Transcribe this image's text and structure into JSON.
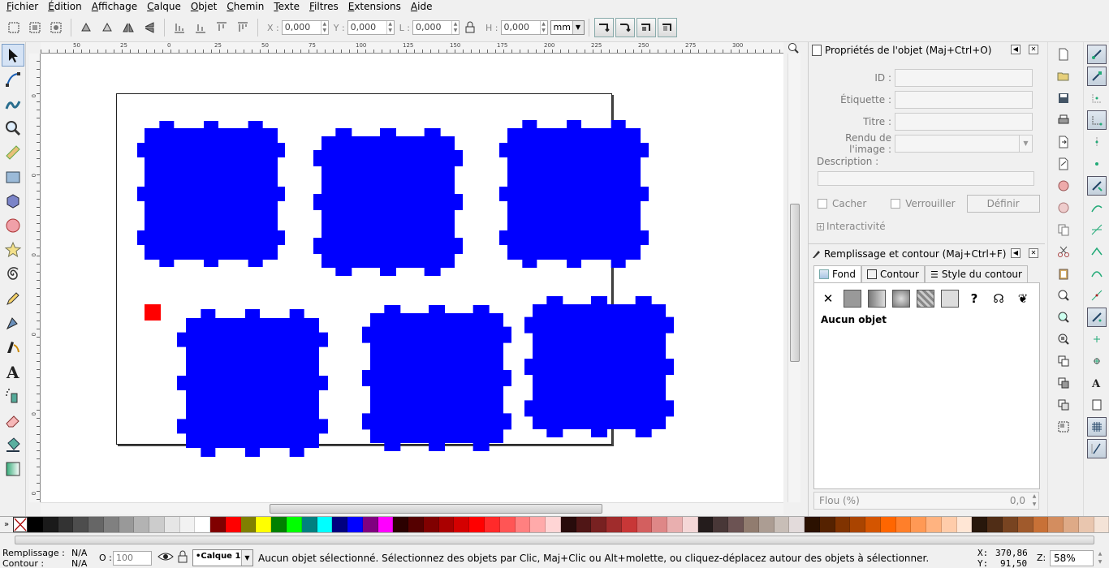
{
  "menu": [
    "Fichier",
    "Édition",
    "Affichage",
    "Calque",
    "Objet",
    "Chemin",
    "Texte",
    "Filtres",
    "Extensions",
    "Aide"
  ],
  "toolbar": {
    "x_label": "X :",
    "x_value": "0,000",
    "y_label": "Y :",
    "y_value": "0,000",
    "w_label": "L :",
    "w_value": "0,000",
    "h_label": "H :",
    "h_value": "0,000",
    "unit": "mm"
  },
  "ruler_top_labels": [
    "50",
    "25",
    "0",
    "25",
    "50",
    "75",
    "100",
    "125",
    "150",
    "175",
    "200",
    "225",
    "250",
    "275",
    "300"
  ],
  "ruler_left_labels": [
    "0",
    "0",
    "0",
    "0",
    "0",
    "0"
  ],
  "canvas": {
    "piece_color": "#0000ff",
    "marker_color": "#ff0000",
    "page_border_color": "#222222"
  },
  "object_properties": {
    "title": "Propriétés de l'objet (Maj+Ctrl+O)",
    "id_label": "ID :",
    "label_label": "Étiquette :",
    "title_label": "Titre :",
    "render_label": "Rendu de l'image :",
    "description_label": "Description :",
    "hide_label": "Cacher",
    "lock_label": "Verrouiller",
    "set_button": "Définir",
    "interactivity_label": "Interactivité"
  },
  "fill_stroke": {
    "title": "Remplissage et contour (Maj+Ctrl+F)",
    "tab_fill": "Fond",
    "tab_stroke": "Contour",
    "tab_stroke_style": "Style du contour",
    "no_object": "Aucun objet",
    "blur_label": "Flou (%)",
    "blur_value": "0,0"
  },
  "palette_colors": [
    "#000000",
    "#1a1a1a",
    "#333333",
    "#4d4d4d",
    "#666666",
    "#808080",
    "#999999",
    "#b3b3b3",
    "#cccccc",
    "#e6e6e6",
    "#f2f2f2",
    "#ffffff",
    "#800000",
    "#ff0000",
    "#808000",
    "#ffff00",
    "#008000",
    "#00ff00",
    "#008080",
    "#00ffff",
    "#000080",
    "#0000ff",
    "#800080",
    "#ff00ff",
    "#2b0000",
    "#550000",
    "#800000",
    "#aa0000",
    "#d40000",
    "#ff0000",
    "#ff2a2a",
    "#ff5555",
    "#ff8080",
    "#ffaaaa",
    "#ffd5d5",
    "#280b0b",
    "#501616",
    "#782121",
    "#a02c2c",
    "#c83737",
    "#d35f5f",
    "#de8787",
    "#e9afaf",
    "#f4d7d7",
    "#241c1c",
    "#483737",
    "#6c5353",
    "#917c6f",
    "#ac9d93",
    "#c8beb7",
    "#e3dbdb",
    "#2b1100",
    "#552200",
    "#803300",
    "#aa4400",
    "#d45500",
    "#ff6600",
    "#ff7f2a",
    "#ff9955",
    "#ffb380",
    "#ffccaa",
    "#ffe6d5",
    "#28170b",
    "#502d16",
    "#784421",
    "#a05a2c",
    "#c87137",
    "#d38d5f",
    "#deaa87",
    "#e9c6af",
    "#f4e3d7"
  ],
  "status": {
    "fill_label": "Remplissage :",
    "fill_value": "N/A",
    "stroke_label": "Contour :",
    "stroke_value": "N/A",
    "opacity_label": "O :",
    "opacity_value": "100",
    "layer": "•Calque 1",
    "message": "Aucun objet sélectionné. Sélectionnez des objets par Clic, Maj+Clic ou Alt+molette, ou cliquez-déplacez autour des objets à sélectionner.",
    "x_label": "X:",
    "x_value": "370,86",
    "y_label": "Y:",
    "y_value": "91,50",
    "zoom_label": "Z:",
    "zoom_value": "58%"
  }
}
